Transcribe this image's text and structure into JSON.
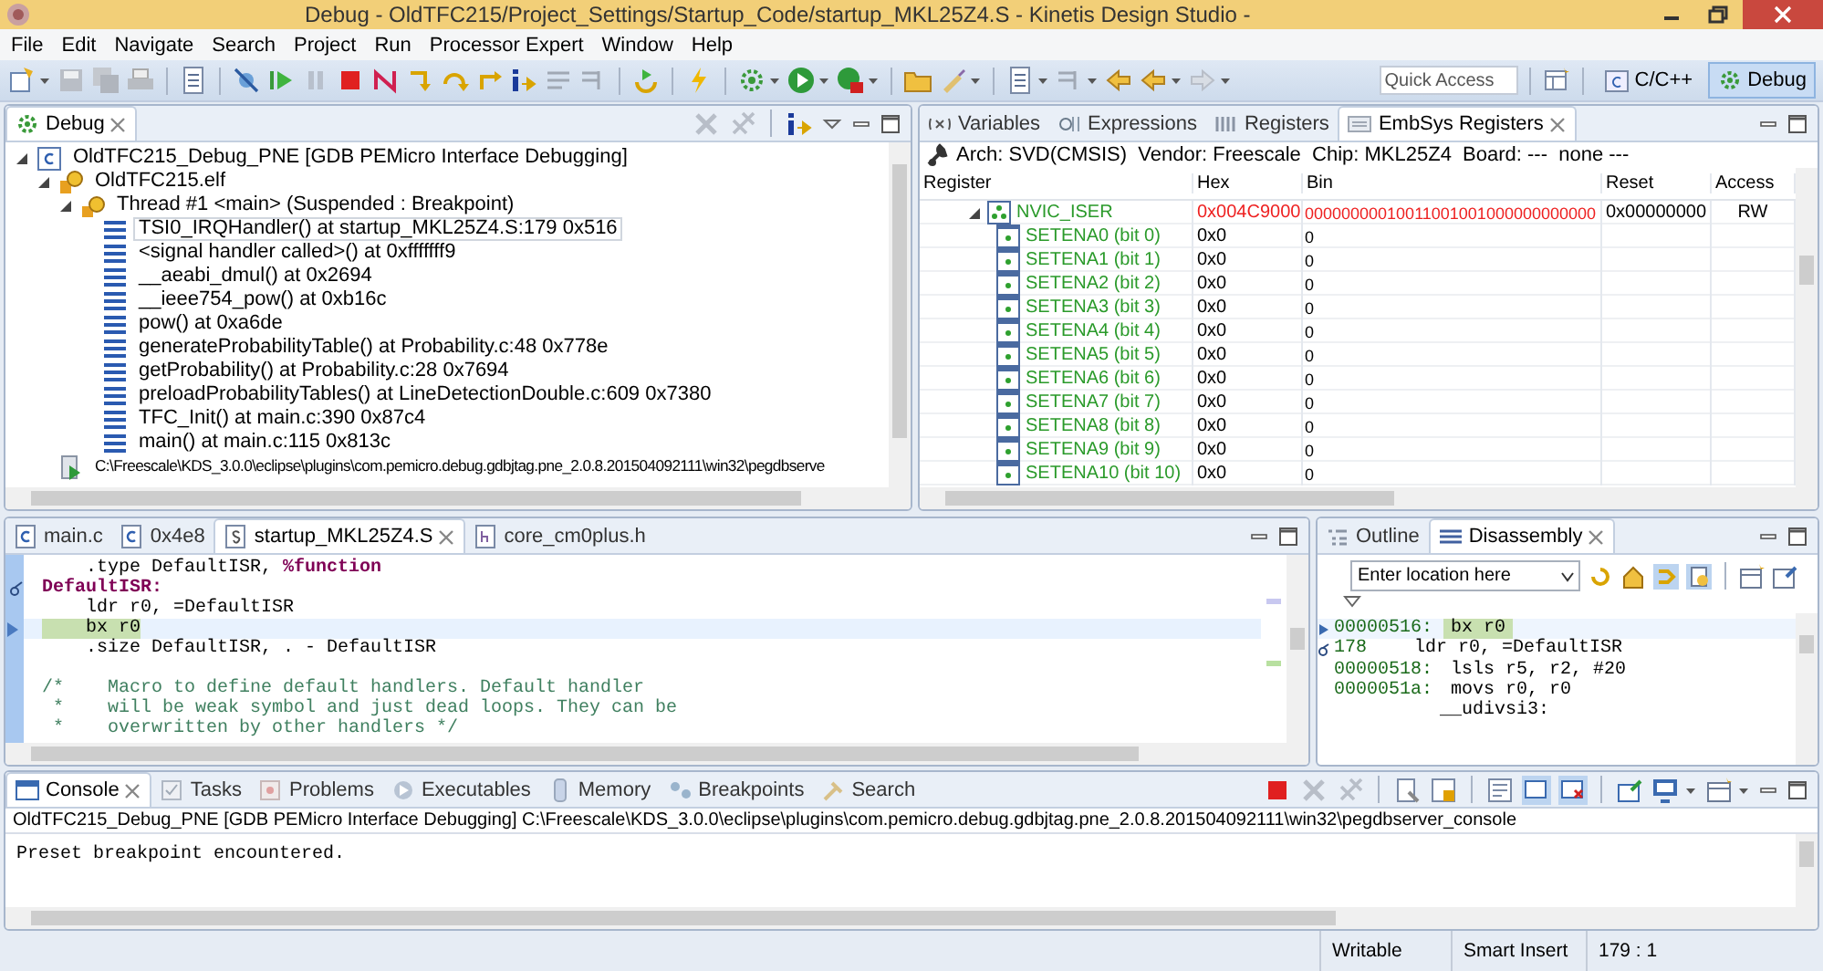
{
  "window": {
    "title": "Debug - OldTFC215/Project_Settings/Startup_Code/startup_MKL25Z4.S - Kinetis Design Studio -"
  },
  "menu": [
    "File",
    "Edit",
    "Navigate",
    "Search",
    "Project",
    "Run",
    "Processor Expert",
    "Window",
    "Help"
  ],
  "toolbar": {
    "quick_access": {
      "placeholder": "Quick Access"
    },
    "perspectives": [
      {
        "label": "C/C++",
        "kind": "cpp",
        "selected": false
      },
      {
        "label": "Debug",
        "kind": "debug",
        "selected": true
      }
    ]
  },
  "debug_view": {
    "tabs": [
      {
        "label": "Debug",
        "selected": true
      }
    ],
    "tree": [
      {
        "label": "OldTFC215_Debug_PNE [GDB PEMicro Interface Debugging]",
        "kind": "launch",
        "expanded": true,
        "selected": false,
        "children": [
          {
            "label": "OldTFC215.elf",
            "kind": "program",
            "expanded": true,
            "selected": false,
            "children": [
              {
                "label": "Thread #1 <main> (Suspended : Breakpoint)",
                "kind": "thread",
                "expanded": true,
                "selected": false,
                "children": [
                  {
                    "label": "TSI0_IRQHandler() at startup_MKL25Z4.S:179 0x516",
                    "kind": "frame",
                    "selected": true
                  },
                  {
                    "label": "<signal handler called>() at 0xfffffff9",
                    "kind": "frame",
                    "selected": false
                  },
                  {
                    "label": "__aeabi_dmul() at 0x2694",
                    "kind": "frame",
                    "selected": false
                  },
                  {
                    "label": "__ieee754_pow() at 0xb16c",
                    "kind": "frame",
                    "selected": false
                  },
                  {
                    "label": "pow() at 0xa6de",
                    "kind": "frame",
                    "selected": false
                  },
                  {
                    "label": "generateProbabilityTable() at Probability.c:48 0x778e",
                    "kind": "frame",
                    "selected": false
                  },
                  {
                    "label": "getProbability() at Probability.c:28 0x7694",
                    "kind": "frame",
                    "selected": false
                  },
                  {
                    "label": "preloadProbabilityTables() at LineDetectionDouble.c:609 0x7380",
                    "kind": "frame",
                    "selected": false
                  },
                  {
                    "label": "TFC_Init() at main.c:390 0x87c4",
                    "kind": "frame",
                    "selected": false
                  },
                  {
                    "label": "main() at main.c:115 0x813c",
                    "kind": "frame",
                    "selected": false
                  }
                ]
              }
            ]
          },
          {
            "label": "C:\\Freescale\\KDS_3.0.0\\eclipse\\plugins\\com.pemicro.debug.gdbjtag.pne_2.0.8.201504092111\\win32\\pegdbserve",
            "kind": "process",
            "selected": false
          }
        ]
      }
    ]
  },
  "registers_view": {
    "tabs": [
      {
        "label": "Variables",
        "kind": "variables",
        "selected": false
      },
      {
        "label": "Expressions",
        "kind": "expressions",
        "selected": false
      },
      {
        "label": "Registers",
        "kind": "registers",
        "selected": false
      },
      {
        "label": "EmbSys Registers",
        "kind": "embsys",
        "selected": true
      }
    ],
    "info": "Arch: SVD(CMSIS)  Vendor: Freescale  Chip: MKL25Z4  Board: ---  none ---",
    "columns": [
      "Register",
      "Hex",
      "Bin",
      "Reset",
      "Access"
    ],
    "rows": [
      {
        "name": "NVIC_ISER",
        "hex": "0x004C9000",
        "bin": "00000000010011001001000000000000",
        "reset": "0x00000000",
        "access": "RW",
        "changed": true,
        "expanded": true,
        "children": [
          {
            "name": "SETENA0 (bit 0)",
            "hex": "0x0",
            "bin": "0",
            "changed": false
          },
          {
            "name": "SETENA1 (bit 1)",
            "hex": "0x0",
            "bin": "0",
            "changed": false
          },
          {
            "name": "SETENA2 (bit 2)",
            "hex": "0x0",
            "bin": "0",
            "changed": false
          },
          {
            "name": "SETENA3 (bit 3)",
            "hex": "0x0",
            "bin": "0",
            "changed": false
          },
          {
            "name": "SETENA4 (bit 4)",
            "hex": "0x0",
            "bin": "0",
            "changed": false
          },
          {
            "name": "SETENA5 (bit 5)",
            "hex": "0x0",
            "bin": "0",
            "changed": false
          },
          {
            "name": "SETENA6 (bit 6)",
            "hex": "0x0",
            "bin": "0",
            "changed": false
          },
          {
            "name": "SETENA7 (bit 7)",
            "hex": "0x0",
            "bin": "0",
            "changed": false
          },
          {
            "name": "SETENA8 (bit 8)",
            "hex": "0x0",
            "bin": "0",
            "changed": false
          },
          {
            "name": "SETENA9 (bit 9)",
            "hex": "0x0",
            "bin": "0",
            "changed": false
          },
          {
            "name": "SETENA10 (bit 10)",
            "hex": "0x0",
            "bin": "0",
            "changed": false
          }
        ]
      }
    ]
  },
  "editor": {
    "tabs": [
      {
        "label": "main.c",
        "kind": "c",
        "selected": false
      },
      {
        "label": "0x4e8",
        "kind": "c",
        "selected": false
      },
      {
        "label": "startup_MKL25Z4.S",
        "kind": "asm",
        "selected": true
      },
      {
        "label": "core_cm0plus.h",
        "kind": "h",
        "selected": false
      }
    ],
    "lines": [
      {
        "text": "    .type DefaultISR, **%function**",
        "kind": "code",
        "current": false
      },
      {
        "text": "DefaultISR:",
        "kind": "label",
        "current": false,
        "breakpoint": true
      },
      {
        "text": "    ldr r0, =DefaultISR",
        "kind": "code",
        "current": false
      },
      {
        "text": "    bx r0",
        "kind": "code",
        "current": true
      },
      {
        "text": "    .size DefaultISR, . - DefaultISR",
        "kind": "code",
        "current": false
      },
      {
        "kind": "blank",
        "current": false
      },
      {
        "text": "/*    Macro to define default handlers. Default handler",
        "kind": "comment",
        "current": false
      },
      {
        "text": " *    will be weak symbol and just dead loops. They can be",
        "kind": "comment",
        "current": false
      },
      {
        "text": " *    overwritten by other handlers */",
        "kind": "comment",
        "current": false
      }
    ]
  },
  "disassembly_view": {
    "tabs": [
      {
        "label": "Outline",
        "kind": "outline",
        "selected": false
      },
      {
        "label": "Disassembly",
        "kind": "disassembly",
        "selected": true
      }
    ],
    "location": {
      "placeholder": "Enter location here"
    },
    "lines": [
      {
        "address": "00000516:",
        "code": "bx r0",
        "kind": "instruction",
        "current": true
      },
      {
        "address": "178",
        "code": "ldr r0, =DefaultISR",
        "kind": "source",
        "current": false
      },
      {
        "address": "00000518:",
        "code": "lsls r5, r2, #20",
        "kind": "instruction",
        "current": false
      },
      {
        "address": "0000051a:",
        "code": "movs r0, r0",
        "kind": "instruction",
        "current": false
      },
      {
        "code": "__udivsi3:",
        "kind": "symbol",
        "current": false
      }
    ]
  },
  "console_view": {
    "tabs": [
      {
        "label": "Console",
        "kind": "console",
        "selected": true
      },
      {
        "label": "Tasks",
        "kind": "tasks",
        "selected": false
      },
      {
        "label": "Problems",
        "kind": "problems",
        "selected": false
      },
      {
        "label": "Executables",
        "kind": "executables",
        "selected": false
      },
      {
        "label": "Memory",
        "kind": "memory",
        "selected": false
      },
      {
        "label": "Breakpoints",
        "kind": "breakpoints",
        "selected": false
      },
      {
        "label": "Search",
        "kind": "search",
        "selected": false
      }
    ],
    "process": "OldTFC215_Debug_PNE [GDB PEMicro Interface Debugging] C:\\Freescale\\KDS_3.0.0\\eclipse\\plugins\\com.pemicro.debug.gdbjtag.pne_2.0.8.201504092111\\win32\\pegdbserver_console",
    "output": "Preset breakpoint encountered."
  },
  "status_bar": [
    "Writable",
    "Smart Insert",
    "179 : 1"
  ]
}
